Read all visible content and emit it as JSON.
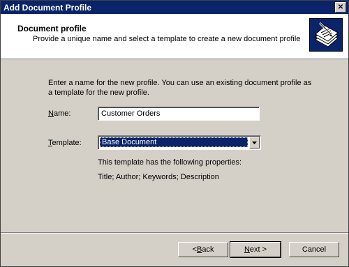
{
  "window": {
    "title": "Add Document Profile",
    "close_glyph": "✕"
  },
  "header": {
    "title": "Document profile",
    "subtitle": "Provide a unique name and select a template to create a new document profile",
    "icon": "document-profile-icon"
  },
  "main": {
    "instructions": "Enter a name for the new profile. You can use an existing document profile as a template for the new profile.",
    "name_label_pre": "",
    "name_label_accel": "N",
    "name_label_post": "ame:",
    "name_value": "Customer Orders",
    "template_label_pre": "",
    "template_label_accel": "T",
    "template_label_post": "emplate:",
    "template_value": "Base Document",
    "properties_intro": "This template has the following properties:",
    "properties_list": "Title; Author; Keywords; Description"
  },
  "buttons": {
    "back_pre": "< ",
    "back_accel": "B",
    "back_post": "ack",
    "next_pre": "",
    "next_accel": "N",
    "next_post": "ext >",
    "cancel": "Cancel"
  },
  "colors": {
    "titlebar": "#0a246a",
    "dialog_bg": "#d4d0c8",
    "selection": "#0a246a"
  }
}
